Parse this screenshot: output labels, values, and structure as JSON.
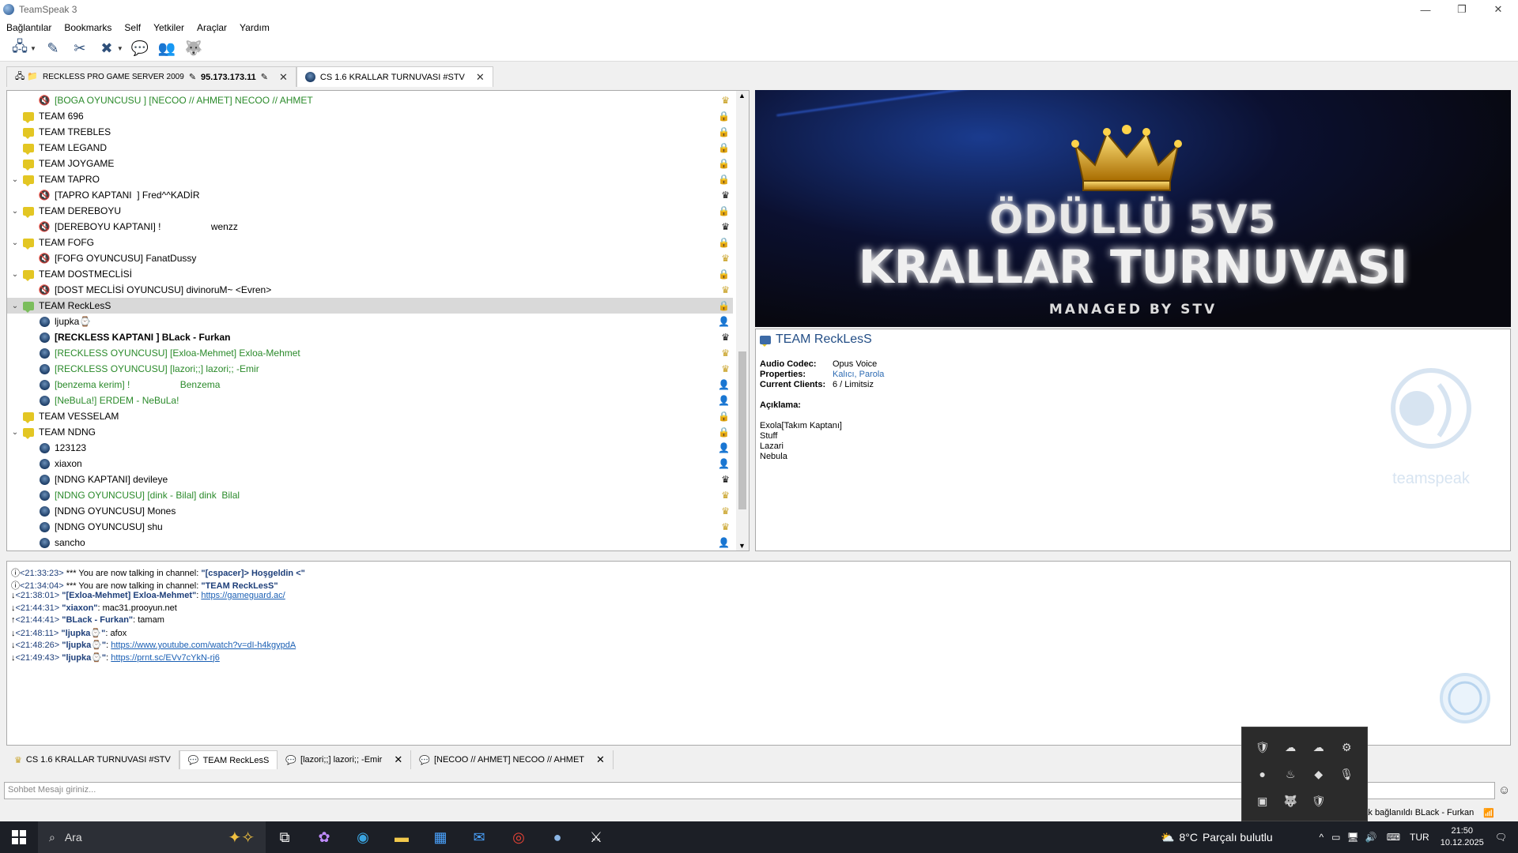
{
  "window": {
    "title": "TeamSpeak 3"
  },
  "menu": [
    "Bağlantılar",
    "Bookmarks",
    "Self",
    "Yetkiler",
    "Araçlar",
    "Yardım"
  ],
  "server_tabs": [
    {
      "label": "RECKLESS PRO GAME SERVER 2009",
      "extra": "95.173.173.11",
      "active": false
    },
    {
      "label": "CS 1.6 KRALLAR TURNUVASI #STV",
      "active": true
    }
  ],
  "tree": [
    {
      "type": "client",
      "indent": 2,
      "text": "[BOGA OYUNCUSU ] [NECOO // AHMET] NECOO // AHMET",
      "color": "green",
      "icon": "speaker",
      "right": "gold-crown"
    },
    {
      "type": "channel",
      "indent": 1,
      "text": "TEAM 696",
      "right": "lock"
    },
    {
      "type": "channel",
      "indent": 1,
      "text": "TEAM TREBLES",
      "right": "lock"
    },
    {
      "type": "channel",
      "indent": 1,
      "text": "TEAM LEGAND",
      "right": "lock"
    },
    {
      "type": "channel",
      "indent": 1,
      "text": "TEAM JOYGAME",
      "right": "lock"
    },
    {
      "type": "channel",
      "indent": 1,
      "text": "TEAM TAPRO",
      "exp": true,
      "right": "lock"
    },
    {
      "type": "client",
      "indent": 2,
      "text": "[TAPRO KAPTANI  ] Fred^^KADİR",
      "icon": "speaker",
      "right": "black-crown"
    },
    {
      "type": "channel",
      "indent": 1,
      "text": "TEAM DEREBOYU",
      "exp": true,
      "right": "lock"
    },
    {
      "type": "client",
      "indent": 2,
      "text": "[DEREBOYU KAPTANI] !                   wenzz",
      "icon": "speaker",
      "right": "black-crown"
    },
    {
      "type": "channel",
      "indent": 1,
      "text": "TEAM FOFG",
      "exp": true,
      "right": "lock"
    },
    {
      "type": "client",
      "indent": 2,
      "text": "[FOFG OYUNCUSU] FanatDussy",
      "icon": "speaker",
      "right": "gold-crown"
    },
    {
      "type": "channel",
      "indent": 1,
      "text": "TEAM DOSTMECLİSİ",
      "exp": true,
      "right": "lock"
    },
    {
      "type": "client",
      "indent": 2,
      "text": "[DOST MECLİSİ OYUNCUSU] divinoruM~ <Evren>",
      "icon": "speaker",
      "right": "gold-crown"
    },
    {
      "type": "channel",
      "indent": 1,
      "text": "TEAM ReckLesS",
      "exp": true,
      "right": "lock",
      "selected": true,
      "green": true
    },
    {
      "type": "client",
      "indent": 2,
      "text": "ljupka⌚",
      "icon": "client",
      "right": "user-red"
    },
    {
      "type": "client",
      "indent": 2,
      "text": "[RECKLESS KAPTANI ] BLack - Furkan",
      "bold": true,
      "icon": "client",
      "right": "black-crown-wolf"
    },
    {
      "type": "client",
      "indent": 2,
      "text": "[RECKLESS OYUNCUSU] [Exloa-Mehmet] Exloa-Mehmet",
      "color": "green",
      "icon": "client",
      "right": "gold-crown"
    },
    {
      "type": "client",
      "indent": 2,
      "text": "[RECKLESS OYUNCUSU] [lazori;;] lazori;; -Emir",
      "color": "green",
      "icon": "client",
      "right": "gold-crown"
    },
    {
      "type": "client",
      "indent": 2,
      "text": "[benzema kerim] !                   Benzema",
      "color": "green",
      "icon": "client",
      "right": "user-blue"
    },
    {
      "type": "client",
      "indent": 2,
      "text": "[NeBuLa!] ERDEM - NeBuLa!",
      "color": "green",
      "icon": "client",
      "right": "user-blue"
    },
    {
      "type": "channel",
      "indent": 1,
      "text": "TEAM VESSELAM",
      "right": "lock"
    },
    {
      "type": "channel",
      "indent": 1,
      "text": "TEAM NDNG",
      "exp": true,
      "right": "lock"
    },
    {
      "type": "client",
      "indent": 2,
      "text": "123123",
      "icon": "client",
      "right": "user-lock"
    },
    {
      "type": "client",
      "indent": 2,
      "text": "xiaxon",
      "icon": "client",
      "right": "user-lock"
    },
    {
      "type": "client",
      "indent": 2,
      "text": "[NDNG KAPTANI] devileye",
      "icon": "client",
      "right": "black-crown"
    },
    {
      "type": "client",
      "indent": 2,
      "text": "[NDNG OYUNCUSU] [dink - Bilal] dink  Bilal",
      "color": "green",
      "icon": "client",
      "right": "gold-crown"
    },
    {
      "type": "client",
      "indent": 2,
      "text": "[NDNG OYUNCUSU] Mones",
      "icon": "client",
      "right": "gold-crown"
    },
    {
      "type": "client",
      "indent": 2,
      "text": "[NDNG OYUNCUSU] shu",
      "icon": "client",
      "right": "gold-crown"
    },
    {
      "type": "client",
      "indent": 2,
      "text": "sancho",
      "icon": "client",
      "right": "user-blue-wolf"
    }
  ],
  "banner": {
    "line1": "ÖDÜLLÜ 5V5",
    "line2": "KRALLAR TURNUVASI",
    "line3": "MANAGED BY STV"
  },
  "info": {
    "title": "TEAM ReckLesS",
    "audio_codec_label": "Audio Codec:",
    "audio_codec": "Opus Voice",
    "properties_label": "Properties:",
    "properties": "Kalıcı, Parola",
    "clients_label": "Current Clients:",
    "clients": "6 / Limitsiz",
    "desc_label": "Açıklama:",
    "desc_lines": [
      "Exola[Takım Kaptanı]",
      "Stuff",
      "Lazari",
      "Nebula"
    ],
    "logo_text": "teamspeak"
  },
  "chat": [
    {
      "icon": "ⓘ",
      "ts": "<21:33:23>",
      "pre": " *** You are now talking in channel: ",
      "name": "\"[cspacer]> Hoşgeldin <\"",
      "text": "",
      "link": ""
    },
    {
      "icon": "ⓘ",
      "ts": "<21:34:04>",
      "pre": " *** You are now talking in channel: ",
      "name": "\"TEAM ReckLesS\"",
      "text": "",
      "link": ""
    },
    {
      "icon": "↓",
      "ts": "<21:38:01>",
      "pre": " ",
      "name": "\"[Exloa-Mehmet] Exloa-Mehmet\"",
      "text": ": ",
      "link": "https://gameguard.ac/"
    },
    {
      "icon": "↓",
      "ts": "<21:44:31>",
      "pre": " ",
      "name": "\"xiaxon\"",
      "text": ": mac31.prooyun.net",
      "link": ""
    },
    {
      "icon": "↑",
      "ts": "<21:44:41>",
      "pre": " ",
      "name": "\"BLack - Furkan\"",
      "text": ": tamam",
      "link": ""
    },
    {
      "icon": "↓",
      "ts": "<21:48:11>",
      "pre": " ",
      "name": "\"ljupka⌚\"",
      "text": ": afox",
      "link": ""
    },
    {
      "icon": "↓",
      "ts": "<21:48:26>",
      "pre": " ",
      "name": "\"ljupka⌚\"",
      "text": ": ",
      "link": "https://www.youtube.com/watch?v=dI-h4kgypdA"
    },
    {
      "icon": "↓",
      "ts": "<21:49:43>",
      "pre": " ",
      "name": "\"ljupka⌚\"",
      "text": ": ",
      "link": "https://prnt.sc/EVv7cYkN-rj6"
    }
  ],
  "chat_tabs": [
    {
      "label": "CS 1.6 KRALLAR TURNUVASI #STV",
      "icon": "♛",
      "closable": false,
      "active": false
    },
    {
      "label": "TEAM ReckLesS",
      "icon": "💬",
      "closable": false,
      "active": true
    },
    {
      "label": "[lazori;;] lazori;; -Emir",
      "icon": "💬",
      "closable": true,
      "active": false
    },
    {
      "label": "[NECOO // AHMET] NECOO // AHMET",
      "icon": "💬",
      "closable": true,
      "active": false
    }
  ],
  "message_placeholder": "Sohbet Mesajı giriniz...",
  "status_text": "olarak bağlanıldı BLack - Furkan",
  "taskbar": {
    "search": "Ara",
    "weather_temp": "8°C",
    "weather_text": "Parçalı bulutlu",
    "lang": "TUR",
    "time": "21:50",
    "date": "10.12.2025"
  }
}
